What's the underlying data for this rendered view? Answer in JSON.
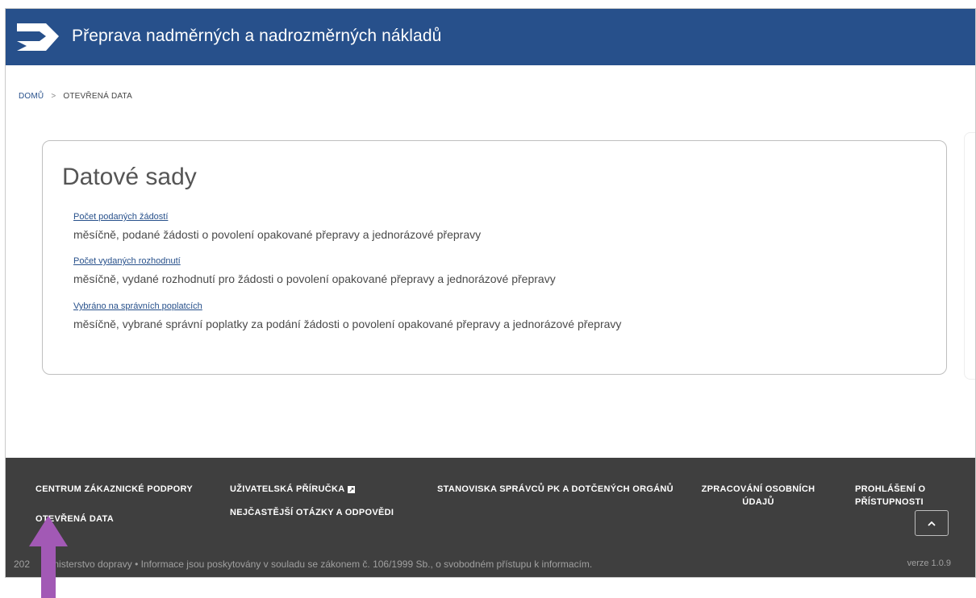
{
  "header": {
    "title": "Přeprava nadměrných a nadrozměrných nákladů",
    "background_color": "#27508b"
  },
  "breadcrumb": {
    "home": "DOMŮ",
    "separator": ">",
    "current": "OTEVŘENÁ DATA"
  },
  "datasets": {
    "title": "Datové sady",
    "items": [
      {
        "link": "Počet podaných žádostí",
        "description": "měsíčně, podané žádosti o povolení opakované přepravy a jednorázové přepravy"
      },
      {
        "link": "Počet vydaných rozhodnutí",
        "description": "měsíčně, vydané rozhodnutí pro žádosti o povolení opakované přepravy a jednorázové přepravy"
      },
      {
        "link": "Vybráno na správních poplatcích",
        "description": "měsíčně, vybrané správní poplatky za podání žádosti o povolení opakované přepravy a jednorázové přepravy"
      }
    ]
  },
  "footer": {
    "links": {
      "support": "CENTRUM ZÁKAZNICKÉ PODPORY",
      "open_data": "OTEVŘENÁ DATA",
      "manual": "UŽIVATELSKÁ PŘÍRUČKA",
      "faq": "NEJČASTĚJŠÍ OTÁZKY A ODPOVĚDI",
      "opinions": "STANOVISKA SPRÁVCŮ PK A DOTČENÝCH ORGÁNŮ",
      "personal_data": "ZPRACOVÁNÍ OSOBNÍCH ÚDAJŮ",
      "accessibility": "PROHLÁŠENÍ O PŘÍSTUPNOSTI"
    },
    "scroll_top_icon": "chevron-up-icon",
    "copyright": "202     Ministerstvo dopravy • Informace jsou poskytovány v souladu se zákonem č. 106/1999 Sb., o svobodném přístupu k informacím.",
    "version": "verze 1.0.9",
    "background_color": "#3f3f3f"
  },
  "annotation": {
    "arrow_color": "#a259b5",
    "arrow_icon": "up-arrow-icon"
  }
}
